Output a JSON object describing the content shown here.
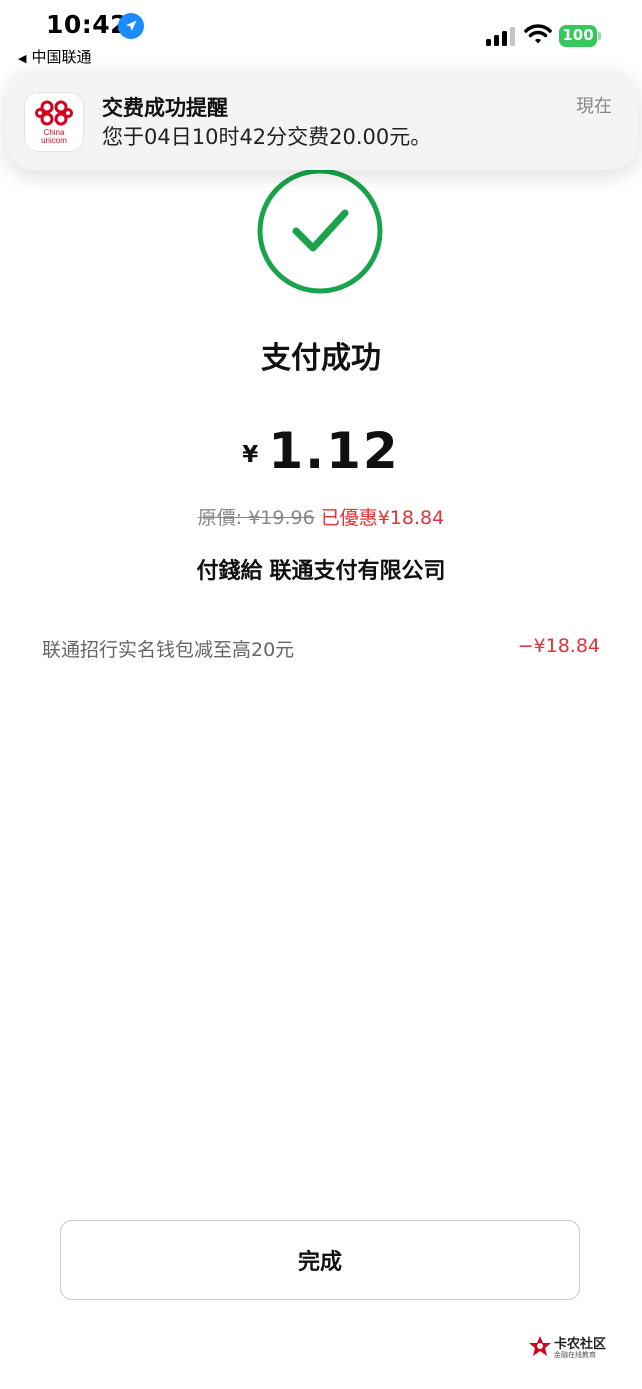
{
  "status_bar": {
    "time": "10:42",
    "back_label": "中国联通",
    "battery": "100",
    "colors": {
      "battery": "#34c759",
      "location": "#1a8cff"
    }
  },
  "notification": {
    "app_brand_line1": "China",
    "app_brand_line2": "unicom",
    "title": "交费成功提醒",
    "body": "您于04日10时42分交费20.00元。",
    "time": "現在"
  },
  "result": {
    "title": "支付成功",
    "currency": "¥",
    "amount": "1.12",
    "original_price": "原價: ¥19.96",
    "discount_summary": "已優惠¥18.84",
    "payee_prefix": "付錢給",
    "payee_name": "联通支付有限公司",
    "colors": {
      "success": "#1aa34a",
      "discount": "#e0343a"
    }
  },
  "discount": {
    "name": "联通招行实名钱包减至高20元",
    "value": "−¥18.84"
  },
  "actions": {
    "done_label": "完成"
  },
  "watermark": {
    "name": "卡农社区",
    "subtitle": "金融在线教育"
  }
}
